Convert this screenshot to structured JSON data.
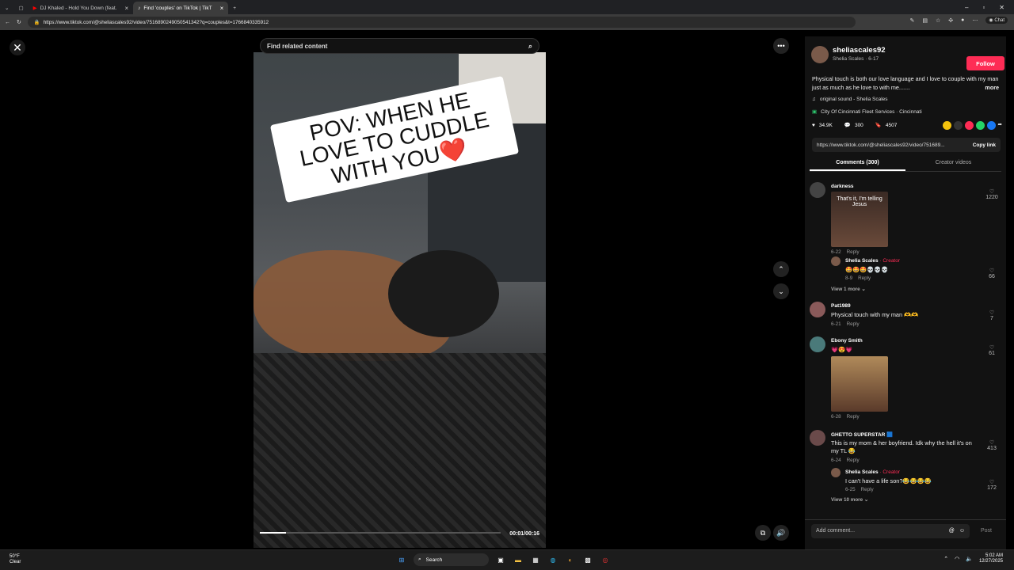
{
  "browser": {
    "tabs": [
      {
        "label": "DJ Khaled - Hold You Down (feat.",
        "active": false
      },
      {
        "label": "Find 'couples' on TikTok | TikT",
        "active": true
      }
    ],
    "url": "https://www.tiktok.com/@sheliascales92/video/7516890249050541342?q=couples&t=1766840335912",
    "chat_label": "Chat"
  },
  "search": {
    "placeholder": "Find related content"
  },
  "video": {
    "caption": "POV: WHEN HE LOVE TO CUDDLE WITH YOU❤️",
    "timecode": "00:01/00:16",
    "progress": 0.11
  },
  "author": {
    "username": "sheliascales92",
    "subtitle": "Shelia Scales · 6-17",
    "follow_label": "Follow",
    "description": "Physical touch is both our love language and I love to couple with my man just as much as he love to with me.......",
    "more_label": "more",
    "sound": "original sound - Shelia Scales",
    "location": "City Of Cincinnati Fleet Services · Cincinnati"
  },
  "stats": {
    "likes": "34.9K",
    "comments": "300",
    "saves": "4507"
  },
  "share_link": {
    "url": "https://www.tiktok.com/@sheliascales92/video/751689...",
    "copy_label": "Copy link"
  },
  "tabs": {
    "comments": "Comments (300)",
    "creator_videos": "Creator videos"
  },
  "comments": [
    {
      "name": "darkness",
      "image_text": "That's it, I'm telling Jesus",
      "date": "6-22",
      "reply": "Reply",
      "likes": "1220"
    },
    {
      "name": "Shelia Scales",
      "creator_tag": "· Creator",
      "text": "🤩🤩🤩💀💀💀",
      "date": "8-9",
      "reply": "Reply",
      "likes": "66"
    },
    {
      "view_more": "View 1 more"
    },
    {
      "name": "Pat1989",
      "text": "Physical touch with my man 🫶🫶",
      "date": "6-21",
      "reply": "Reply",
      "likes": "7"
    },
    {
      "name": "Ebony Smith",
      "text": "💗😍💗",
      "date": "6-28",
      "reply": "Reply",
      "likes": "61"
    },
    {
      "name": "GHETTO SUPERSTAR 🟦",
      "text": "This is my mom & her boyfriend. Idk why the hell it's on my TL 😂",
      "date": "6-24",
      "reply": "Reply",
      "likes": "413"
    },
    {
      "name": "Shelia Scales",
      "creator_tag": "· Creator",
      "text": "I can't have a life son?😂😂😂😂",
      "date": "6-25",
      "reply": "Reply",
      "likes": "172"
    },
    {
      "view_more": "View 10 more"
    }
  ],
  "add_comment": {
    "placeholder": "Add comment...",
    "post_label": "Post"
  },
  "taskbar": {
    "weather_temp": "50°F",
    "weather_desc": "Clear",
    "search_label": "Search",
    "time": "5:02 AM",
    "date": "12/27/2025"
  },
  "colors": {
    "accent": "#fe2c55",
    "panel": "#121212",
    "background": "#000000"
  }
}
